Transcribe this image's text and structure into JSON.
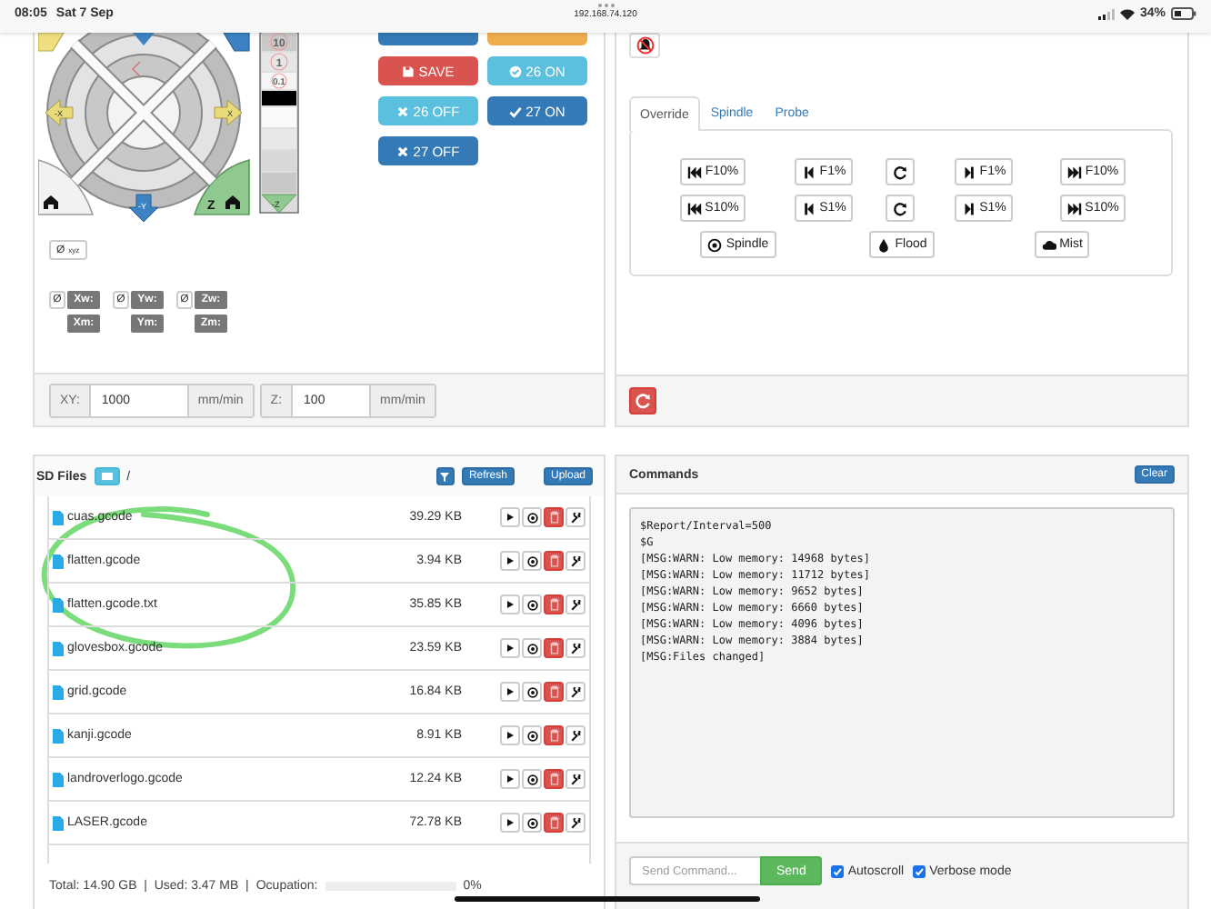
{
  "status_bar": {
    "time": "08:05",
    "date": "Sat 7 Sep",
    "address": "192.168.74.120",
    "battery": "34%"
  },
  "jog": {
    "labels": {
      "x_minus": "-X",
      "x_plus": "X",
      "y_minus": "-Y",
      "z": "Z",
      "z_minus": "-Z"
    },
    "z_steps": [
      "10",
      "1",
      "0.1"
    ],
    "macros": [
      {
        "kind": "cut",
        "color": "#337ab7"
      },
      {
        "kind": "cut",
        "color": "#f0ad4e"
      },
      {
        "kind": "save",
        "color": "#d9534f",
        "label": "SAVE"
      },
      {
        "kind": "check_circle",
        "color": "#5bc0de",
        "label": "26 ON"
      },
      {
        "kind": "cross",
        "color": "#5bc0de",
        "label": "26 OFF"
      },
      {
        "kind": "check",
        "color": "#337ab7",
        "label": "27 ON"
      },
      {
        "kind": "cross",
        "color": "#337ab7",
        "label": "27 OFF"
      }
    ],
    "zero_all": "Ø$_{xyz}$",
    "axes": [
      {
        "zero": "Ø",
        "work": "Xw:",
        "machine": "Xm:"
      },
      {
        "zero": "Ø",
        "work": "Yw:",
        "machine": "Ym:"
      },
      {
        "zero": "Ø",
        "work": "Zw:",
        "machine": "Zm:"
      }
    ],
    "feeds": [
      {
        "label": "XY:",
        "value": "1000",
        "unit": "mm/min"
      },
      {
        "label": "Z:",
        "value": "100",
        "unit": "mm/min"
      }
    ]
  },
  "override": {
    "tabs": [
      {
        "label": "Override",
        "selected": true
      },
      {
        "label": "Spindle",
        "selected": false
      },
      {
        "label": "Probe",
        "selected": false
      }
    ],
    "rows": [
      [
        {
          "kind": "fast_back",
          "label": "F10%"
        },
        {
          "kind": "back",
          "label": "F1%"
        },
        {
          "kind": "reset"
        },
        {
          "kind": "forward",
          "label": "F1%"
        },
        {
          "kind": "fast_forward",
          "label": "F10%"
        }
      ],
      [
        {
          "kind": "fast_back",
          "label": "S10%"
        },
        {
          "kind": "back",
          "label": "S1%"
        },
        {
          "kind": "reset"
        },
        {
          "kind": "forward",
          "label": "S1%"
        },
        {
          "kind": "fast_forward",
          "label": "S10%"
        }
      ],
      [
        {
          "kind": "spindle",
          "label": "Spindle"
        },
        {
          "kind": "flood",
          "label": "Flood"
        },
        {
          "kind": "mist",
          "label": "Mist"
        }
      ]
    ]
  },
  "files": {
    "title": "SD Files",
    "path": "/",
    "refresh": "Refresh",
    "upload": "Upload",
    "items": [
      {
        "name": "cuas.gcode",
        "size": "39.29 KB"
      },
      {
        "name": "flatten.gcode",
        "size": "3.94 KB"
      },
      {
        "name": "flatten.gcode.txt",
        "size": "35.85 KB"
      },
      {
        "name": "glovesbox.gcode",
        "size": "23.59 KB"
      },
      {
        "name": "grid.gcode",
        "size": "16.84 KB"
      },
      {
        "name": "kanji.gcode",
        "size": "8.91 KB"
      },
      {
        "name": "landroverlogo.gcode",
        "size": "12.24 KB"
      },
      {
        "name": "LASER.gcode",
        "size": "72.78 KB"
      }
    ],
    "totals": "Total: 14.90 GB  |  Used: 3.47 MB  |",
    "occupation_label": "Ocupation:",
    "occupation": {
      "level": 0
    },
    "occupation_text": "0%"
  },
  "commands": {
    "title": "Commands",
    "clear": "Clear",
    "lines": [
      "$Report/Interval=500",
      "$G",
      "[MSG:WARN: Low memory: 14968 bytes]",
      "[MSG:WARN: Low memory: 11712 bytes]",
      "[MSG:WARN: Low memory: 9652 bytes]",
      "[MSG:WARN: Low memory: 6660 bytes]",
      "[MSG:WARN: Low memory: 4096 bytes]",
      "[MSG:WARN: Low memory: 3884 bytes]",
      "[MSG:Files changed]"
    ],
    "placeholder": "Send Command...",
    "send": "Send",
    "options": [
      {
        "label": "Autoscroll",
        "checked": true
      },
      {
        "label": "Verbose mode",
        "checked": true
      }
    ]
  }
}
